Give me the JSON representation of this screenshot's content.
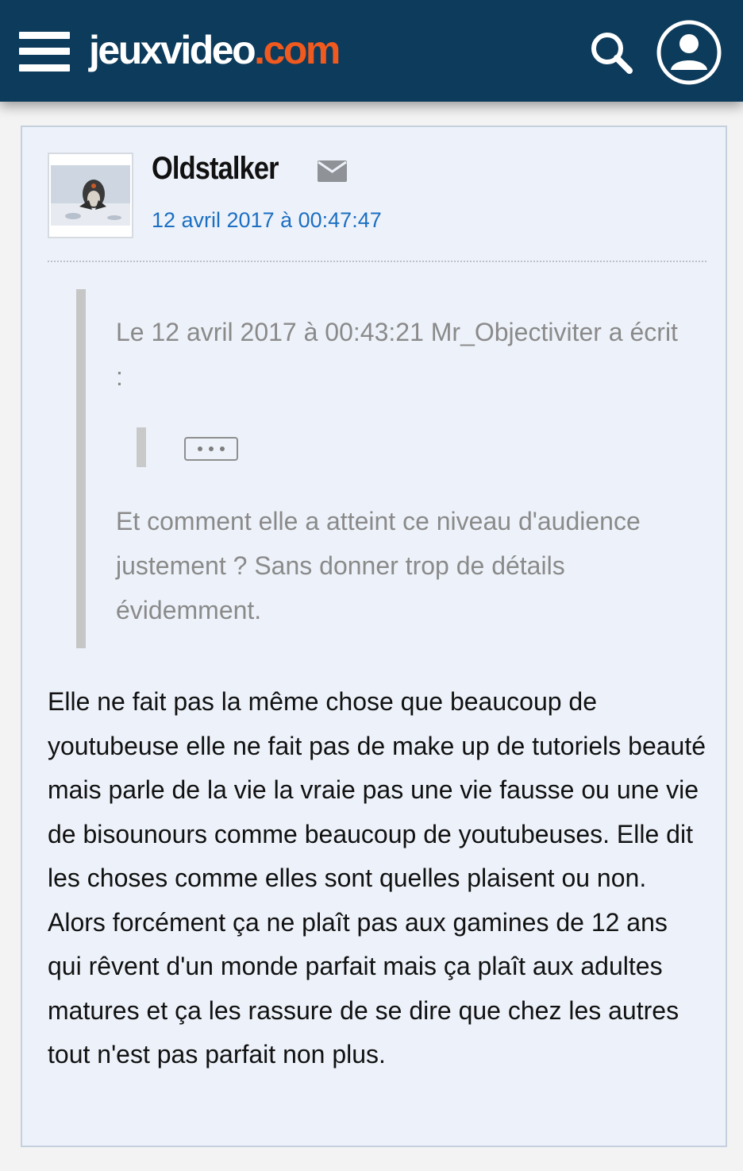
{
  "header": {
    "logo_main": "jeuxvideo",
    "logo_accent": ".com",
    "icons": [
      "menu-icon",
      "search-icon",
      "user-account-icon"
    ],
    "colors": {
      "background": "#0d3b5c",
      "logo_accent": "#f05a1e"
    }
  },
  "post": {
    "author": "Oldstalker",
    "date": "12 avril 2017 à 00:47:47",
    "quote": {
      "header": "Le 12 avril 2017 à 00:43:21 Mr_Objectiviter a écrit :",
      "collapsed_label": "• • •",
      "text": "Et comment elle a atteint ce niveau d'audience justement ? Sans donner trop de détails évidemment."
    },
    "message": "Elle ne fait pas la même chose que beaucoup de youtubeuse elle ne fait pas de make up de tutoriels beauté mais parle de la vie la vraie pas une vie fausse ou une vie de bisounours comme beaucoup de youtubeuses. Elle dit les choses comme elles sont quelles plaisent ou non. Alors forcément ça ne plaît pas aux gamines de 12 ans qui rêvent d'un monde parfait mais ça plaît aux adultes matures et ça les rassure de se dire que chez les autres tout n'est pas parfait non plus.",
    "colors": {
      "card_background": "#edf2fa",
      "date_link": "#1c6fc2",
      "quote_text": "#8a8a8a"
    }
  }
}
